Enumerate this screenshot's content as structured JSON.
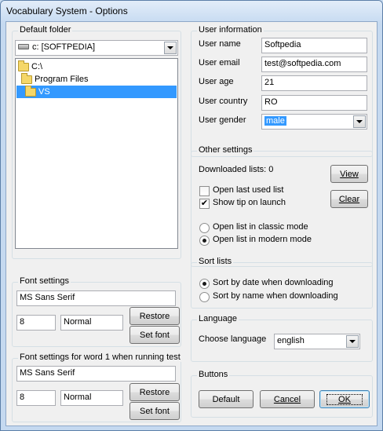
{
  "window": {
    "title": "Vocabulary System - Options"
  },
  "default_folder": {
    "title": "Default folder",
    "drive": "c: [SOFTPEDIA]",
    "tree": [
      "C:\\",
      "Program Files",
      "VS"
    ]
  },
  "font_settings": {
    "title": "Font settings",
    "font_name": "MS Sans Serif",
    "size": "8",
    "style": "Normal",
    "restore": "Restore",
    "set_font": "Set font"
  },
  "font_settings_test": {
    "title": "Font settings for word 1 when running test",
    "font_name": "MS Sans Serif",
    "size": "8",
    "style": "Normal",
    "restore": "Restore",
    "set_font": "Set font"
  },
  "user_info": {
    "title": "User information",
    "name_label": "User name",
    "name_value": "Softpedia",
    "email_label": "User email",
    "email_value": "test@softpedia.com",
    "age_label": "User age",
    "age_value": "21",
    "country_label": "User country",
    "country_value": "RO",
    "gender_label": "User gender",
    "gender_value": "male"
  },
  "other": {
    "title": "Other settings",
    "downloaded": "Downloaded lists: 0",
    "view": "View",
    "clear": "Clear",
    "open_last": "Open last used list",
    "show_tip": "Show tip on launch",
    "classic": "Open list in classic mode",
    "modern": "Open list in modern mode",
    "open_last_checked": false,
    "show_tip_checked": true,
    "mode": "modern"
  },
  "sort": {
    "title": "Sort lists",
    "by_date": "Sort by date when downloading",
    "by_name": "Sort by name when downloading",
    "selected": "date"
  },
  "language": {
    "title": "Language",
    "label": "Choose language",
    "value": "english"
  },
  "buttons": {
    "title": "Buttons",
    "default": "Default",
    "cancel": "Cancel",
    "ok": "OK"
  },
  "colors": {
    "selection": "#3399ff",
    "face": "#f0f0f0"
  }
}
